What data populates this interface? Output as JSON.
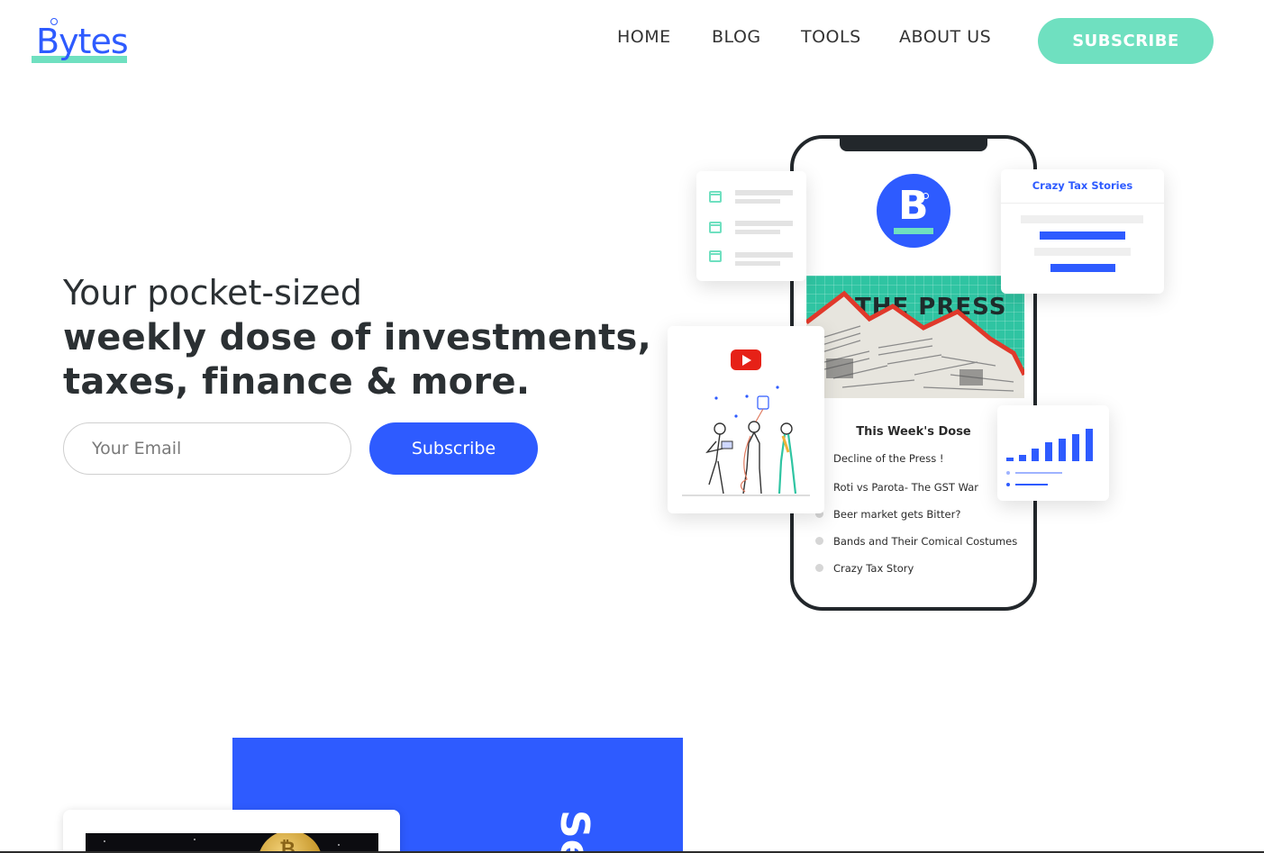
{
  "brand": {
    "logo_text": "Bytes",
    "colors": {
      "primary": "#2e5bff",
      "accent": "#6fe0c0",
      "text": "#2b3033"
    }
  },
  "nav": {
    "items": [
      {
        "label": "HOME"
      },
      {
        "label": "BLOG"
      },
      {
        "label": "TOOLS"
      },
      {
        "label": "ABOUT US"
      }
    ],
    "subscribe_label": "SUBSCRIBE"
  },
  "hero": {
    "line1": "Your pocket-sized",
    "line2": "weekly dose of investments,",
    "line3": "taxes, finance & more.",
    "email_placeholder": "Your Email",
    "subscribe_label": "Subscribe"
  },
  "phone": {
    "logo_letter": "B",
    "banner_title": "THE PRESS",
    "dose_title": "This Week's Dose",
    "dose_items": [
      "Decline of the Press !",
      "Roti vs Parota- The GST War",
      "Beer market gets Bitter?",
      "Bands and Their Comical Costumes",
      "Crazy Tax Story"
    ]
  },
  "cards": {
    "tax_title": "Crazy Tax Stories",
    "icons": [
      "calendar-icon",
      "youtube-icon",
      "bar-chart-icon"
    ]
  },
  "lower": {
    "blue_block_text": "Se"
  }
}
